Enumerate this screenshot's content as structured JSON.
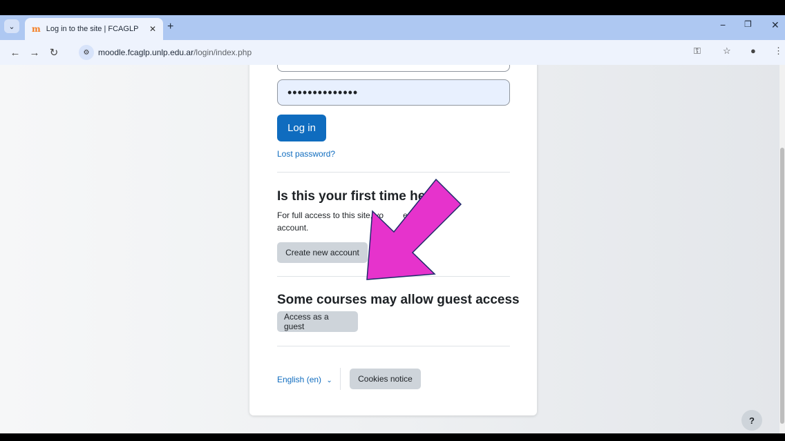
{
  "browser": {
    "tab_title": "Log in to the site | FCAGLP",
    "tab_favicon": "m",
    "url_host": "moodle.fcaglp.unlp.edu.ar",
    "url_path": "/login/index.php"
  },
  "login": {
    "password_value": "••••••••••••••",
    "login_button": "Log in",
    "lost_password": "Lost password?"
  },
  "first_time": {
    "heading": "Is this your first time he",
    "text": "For full access to this site, you first need to create an account.",
    "text_visible_a": "For full access to this site, yo",
    "text_visible_b": "firs",
    "text_visible_c": "eate an",
    "text_visible_d": "account.",
    "button": "Create new account"
  },
  "guest": {
    "heading": "Some courses may allow guest access",
    "button": "Access as a guest"
  },
  "footer": {
    "language": "English (en)",
    "cookies_button": "Cookies notice"
  },
  "help_button": "?",
  "colors": {
    "primary": "#0f6cbf",
    "annotation_arrow": "#e633cc"
  }
}
